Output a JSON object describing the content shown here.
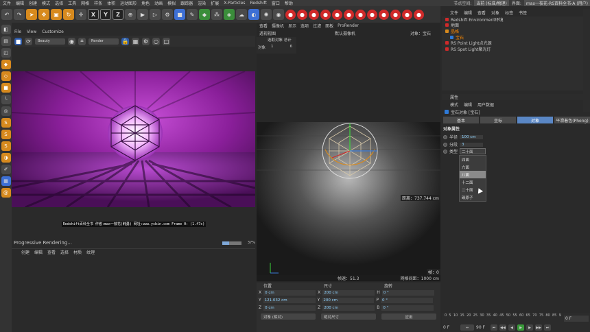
{
  "menubar": {
    "items": [
      "文件",
      "编辑",
      "创建",
      "模式",
      "选择",
      "工具",
      "网格",
      "样条",
      "体积",
      "运动图形",
      "角色",
      "动画",
      "模拟",
      "跟踪器",
      "渲染",
      "扩展",
      "X-Particles",
      "Redshift",
      "窗口",
      "帮助"
    ],
    "node_space_label": "节点空间:",
    "node_space_value": "当前 (标准/物理)",
    "layout_label": "界面:",
    "layout_value": "max一枝花-RS百科全书-A (用户)"
  },
  "toolbar": {
    "axis_x": "X",
    "axis_y": "Y",
    "axis_z": "Z"
  },
  "render_view": {
    "menu": [
      "File",
      "View",
      "Customize"
    ],
    "preset": "Beauty",
    "render_combo": "Render",
    "caption": "Redshift百科全书  作者:max一枝花(韩勇)  网址:www.ysbin.com  Frame  0:  (1.47s)",
    "status_text": "Progressive Rendering...",
    "progress_percent": "37%",
    "progress_fraction": 0.37
  },
  "material_menu": [
    "创建",
    "编辑",
    "查看",
    "选择",
    "材质",
    "纹理"
  ],
  "viewport": {
    "menu": [
      "查看",
      "摄像机",
      "显示",
      "选项",
      "过滤",
      "面板",
      "ProRender"
    ],
    "view_name": "透视视图",
    "camera": "默认摄像机",
    "object_label": "对象：宝石",
    "stats_header": "选取对象  总计",
    "stats_row_label": "对象",
    "stats_selected": "1",
    "stats_total": "6",
    "distance": "距离：737.744 cm",
    "frame": "帧：0",
    "speed": "帧速：51.3",
    "grid": "网格间距：1000 cm"
  },
  "coords": {
    "headers": [
      "位置",
      "尺寸",
      "旋转"
    ],
    "rows": [
      {
        "axis": "X",
        "pos": "0 cm",
        "size_axis": "X",
        "size": "200 cm",
        "rot_axis": "H",
        "rot": "0 °"
      },
      {
        "axis": "Y",
        "pos": "121.032 cm",
        "size_axis": "Y",
        "size": "200 cm",
        "rot_axis": "P",
        "rot": "0 °"
      },
      {
        "axis": "Z",
        "pos": "0 cm",
        "size_axis": "Z",
        "size": "200 cm",
        "rot_axis": "B",
        "rot": "0 °"
      }
    ],
    "mode": "对象 (相对)",
    "size_mode": "绝对尺寸",
    "apply": "应用"
  },
  "object_manager": {
    "menu": [
      "文件",
      "编辑",
      "查看",
      "对象",
      "标签",
      "书签"
    ],
    "items": [
      {
        "name": "Redshift Environment环境",
        "color": "#d02a2a",
        "selected": false
      },
      {
        "name": "地面",
        "color": "#d02a2a",
        "selected": false
      },
      {
        "name": "晶格",
        "color": "#d78a1e",
        "selected": true
      },
      {
        "name": "宝石",
        "color": "#2e7ad8",
        "selected": true
      },
      {
        "name": "RS Point Light点光源",
        "color": "#d02a2a",
        "selected": false
      },
      {
        "name": "RS Spot Light聚光灯",
        "color": "#d02a2a",
        "selected": false
      }
    ]
  },
  "attributes": {
    "header": "属性",
    "menu": [
      "模式",
      "编辑",
      "用户数据"
    ],
    "title": "宝石对象 [宝石]",
    "tabs": [
      "基本",
      "坐标",
      "对象",
      "平滑着色(Phong)"
    ],
    "active_tab": 2,
    "section": "对象属性",
    "radius_label": "半径",
    "radius_value": "100 cm",
    "segments_label": "分段",
    "segments_value": "3",
    "type_label": "类型",
    "type_value": "二十面",
    "type_options": [
      "四面",
      "六面",
      "八面",
      "十二面",
      "二十面",
      "碳原子"
    ],
    "type_highlight": 2
  },
  "timeline": {
    "ticks": [
      "0",
      "5",
      "10",
      "15",
      "20",
      "25",
      "30",
      "35",
      "40",
      "45",
      "50",
      "55",
      "60",
      "65",
      "70",
      "75",
      "80",
      "85",
      "9"
    ],
    "current_frame": "0 F",
    "start_frame": "0 F",
    "end_frame": "90 F"
  },
  "colors": {
    "accent": "#5a87c5",
    "highlight": "#ff8a00",
    "render_purple": "#8a1f9a"
  }
}
